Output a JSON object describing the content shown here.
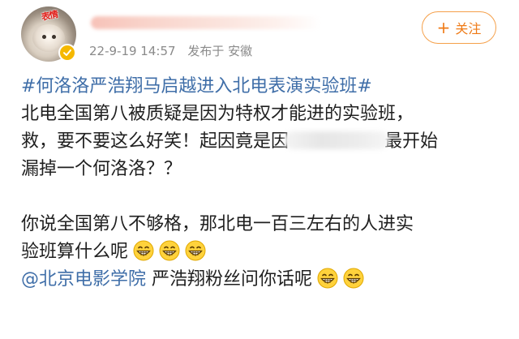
{
  "header": {
    "avatar_text": "表情",
    "timestamp": "22-9-19 14:57",
    "published_from": "发布于 安徽",
    "follow_label": "关注",
    "follow_icon": "plus-icon"
  },
  "post": {
    "hashtag": "#何洛洛严浩翔马启越进入北电表演实验班#",
    "line1": "北电全国第八被质疑是因为特权才能进的实验班，",
    "line2_before": "救，要不要这么好笑！起因竟是因",
    "line2_after": "最开始",
    "line3": "漏掉一个何洛洛？？",
    "line4": "你说全国第八不够格，那北电一百三左右的人进实",
    "line5": "验班算什么呢",
    "mention": "@北京电影学院",
    "line6_after": " 严浩翔粉丝问你话呢",
    "emoji_name": "grin-emoji-icon"
  },
  "colors": {
    "link": "#3f6ea8",
    "follow": "#ef7a16",
    "meta": "#8a8a8a"
  }
}
